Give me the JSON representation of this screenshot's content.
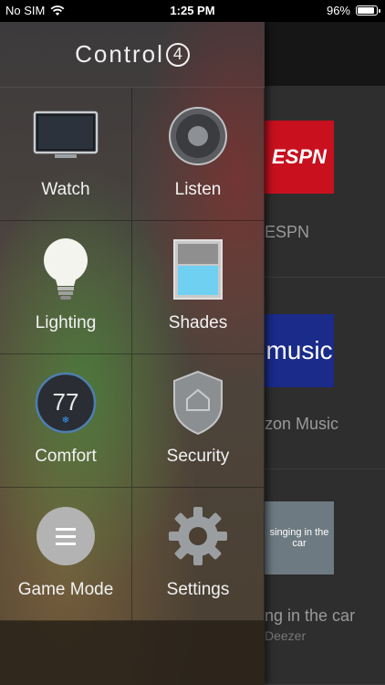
{
  "status": {
    "carrier": "No SIM",
    "time": "1:25 PM",
    "battery": "96%",
    "battery_level": 0.96
  },
  "drawer": {
    "brand": "Control",
    "brand_mark": "4",
    "items": [
      {
        "label": "Watch",
        "icon": "tv-icon"
      },
      {
        "label": "Listen",
        "icon": "speaker-icon"
      },
      {
        "label": "Lighting",
        "icon": "lightbulb-icon"
      },
      {
        "label": "Shades",
        "icon": "shades-icon"
      },
      {
        "label": "Comfort",
        "icon": "thermostat-icon",
        "value": "77"
      },
      {
        "label": "Security",
        "icon": "shield-icon"
      },
      {
        "label": "Game Mode",
        "icon": "menu-icon"
      },
      {
        "label": "Settings",
        "icon": "gear-icon"
      }
    ]
  },
  "background": {
    "espn": {
      "tile": "ESPN",
      "caption": "ESPN"
    },
    "amazon": {
      "tile": "music",
      "caption": "zon Music"
    },
    "deezer": {
      "tile": "singing in the car",
      "caption": "ng in the car",
      "sub": "Deezer"
    }
  },
  "colors": {
    "accent_blue": "#1e90ff",
    "espn_red": "#c8101e"
  }
}
